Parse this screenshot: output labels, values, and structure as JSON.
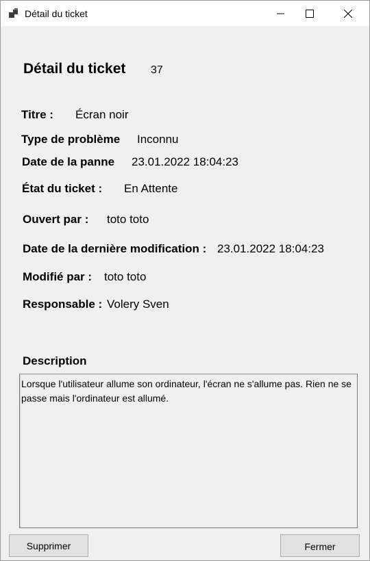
{
  "window": {
    "title": "Détail du ticket"
  },
  "header": {
    "title": "Détail du ticket",
    "ticket_id": "37"
  },
  "fields": {
    "titre": {
      "label": "Titre :",
      "value": "Écran noir"
    },
    "type": {
      "label": "Type de problème",
      "value": "Inconnu"
    },
    "date_panne": {
      "label": "Date de la panne",
      "value": "23.01.2022 18:04:23"
    },
    "etat": {
      "label": "État du ticket :",
      "value": "En Attente"
    },
    "ouvert_par": {
      "label": "Ouvert par :",
      "value": "toto toto"
    },
    "date_modif": {
      "label": "Date de la dernière modification :",
      "value": "23.01.2022 18:04:23"
    },
    "modifie_par": {
      "label": "Modifié par :",
      "value": "toto toto"
    },
    "responsable": {
      "label": "Responsable :",
      "value": "Volery Sven"
    }
  },
  "description": {
    "label": "Description",
    "text": "Lorsque l'utilisateur allume son ordinateur, l'écran ne s'allume pas. Rien ne se passe mais l'ordinateur est allumé."
  },
  "buttons": {
    "delete": "Supprimer",
    "close": "Fermer"
  },
  "icons": {
    "app": "app-window-icon",
    "minimize": "minimize-icon",
    "maximize": "maximize-icon",
    "close": "close-icon"
  }
}
